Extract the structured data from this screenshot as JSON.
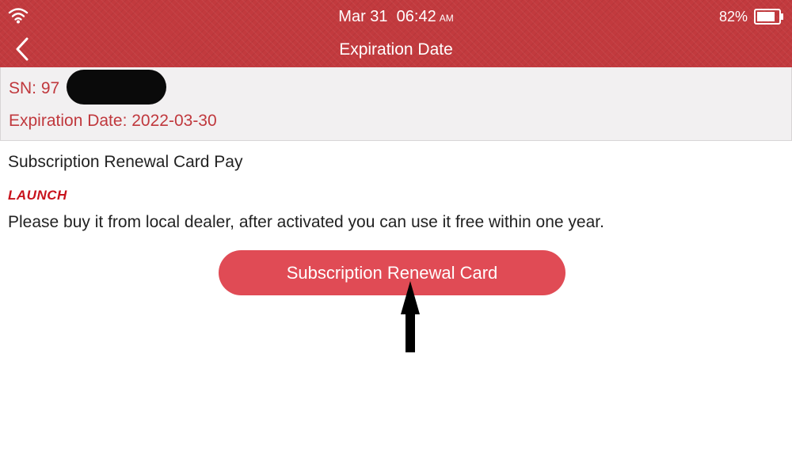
{
  "status_bar": {
    "wifi_icon": "wifi-icon",
    "date": "Mar 31",
    "time": "06:42",
    "ampm": "AM",
    "battery_percent": "82%",
    "battery_icon": "battery-icon"
  },
  "header": {
    "back_icon": "chevron-left-icon",
    "title": "Expiration Date"
  },
  "device_info": {
    "sn_label": "SN: 97",
    "expiration_label": "Expiration Date: 2022-03-30"
  },
  "renewal": {
    "section_title": "Subscription Renewal Card Pay",
    "brand_logo": "LAUNCH",
    "instructions": "Please buy it from local dealer, after activated you can use it free within one year.",
    "button_label": "Subscription Renewal Card"
  },
  "colors": {
    "header": "#c23a3e",
    "accent_text": "#c0383d",
    "button": "#e04b55",
    "logo": "#c8121c"
  }
}
